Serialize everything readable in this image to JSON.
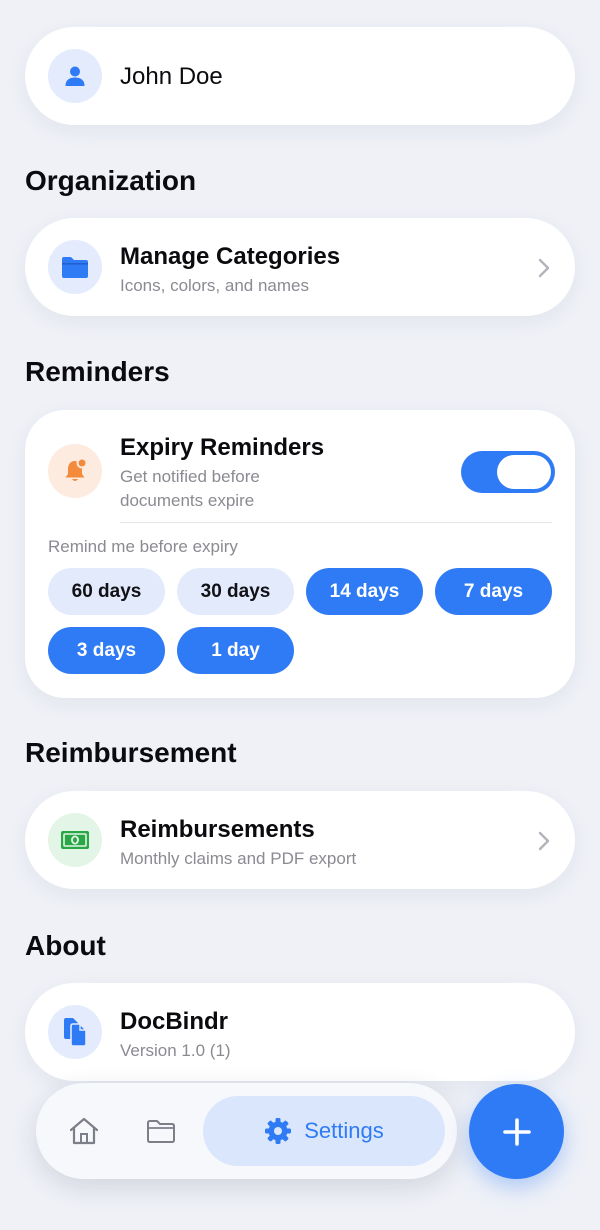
{
  "profile": {
    "name": "John Doe",
    "icon": "person-icon"
  },
  "sections": {
    "organization": "Organization",
    "reminders": "Reminders",
    "reimbursement": "Reimbursement",
    "about": "About"
  },
  "manage_categories": {
    "title": "Manage Categories",
    "subtitle": "Icons, colors, and names",
    "icon": "folder-icon"
  },
  "expiry": {
    "title": "Expiry Reminders",
    "subtitle_line1": "Get notified before",
    "subtitle_line2": "documents expire",
    "enabled": true,
    "remind_label": "Remind me before expiry",
    "options": [
      {
        "label": "60 days",
        "selected": false
      },
      {
        "label": "30 days",
        "selected": false
      },
      {
        "label": "14 days",
        "selected": true
      },
      {
        "label": "7 days",
        "selected": true
      },
      {
        "label": "3 days",
        "selected": true
      },
      {
        "label": "1 day",
        "selected": true
      }
    ]
  },
  "reimbursements": {
    "title": "Reimbursements",
    "subtitle": "Monthly claims and PDF export",
    "icon": "banknote-icon"
  },
  "app": {
    "title": "DocBindr",
    "version": "Version 1.0 (1)",
    "icon": "documents-icon"
  },
  "tabbar": {
    "settings_label": "Settings",
    "active": "settings"
  },
  "colors": {
    "accent": "#2f7bf5",
    "background": "#eff1f7",
    "orange": "#f38a3c",
    "green": "#29a745"
  }
}
